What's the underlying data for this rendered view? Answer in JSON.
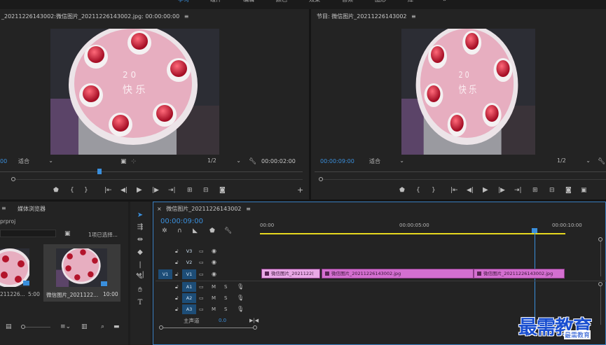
{
  "top_tabs": [
    "学习",
    "组件",
    "编辑",
    "颜色",
    "效果",
    "音频",
    "图形",
    "库"
  ],
  "source_monitor": {
    "title": "_20211226143002:微信图片_20211226143002.jpg: 00:00:00:00",
    "menu_icon": "≡",
    "timecode_left": "00",
    "fit": "适合",
    "resolution": "1/2",
    "timecode_right": "00:00:02:00"
  },
  "program_monitor": {
    "title": "节目: 微信图片_20211226143002",
    "menu_icon": "≡",
    "timecode_left": "00:00:09:00",
    "fit": "适合",
    "resolution": "1/2"
  },
  "image_text": {
    "line1": "2 0",
    "line2": "快 乐"
  },
  "project_panel": {
    "tab_menu": "≡",
    "tab_media_browser": "媒体浏览器",
    "project_file": "prproj",
    "selection_info": "1项已选择...",
    "items": [
      {
        "name": "211226...",
        "duration": "5:00"
      },
      {
        "name": "微信图片_2021122...",
        "duration": "10:00"
      }
    ]
  },
  "timeline": {
    "close": "×",
    "sequence_name": "微信图片_20211226143002",
    "menu_icon": "≡",
    "timecode": "00:00:09:00",
    "ruler": [
      "00:00",
      "00:00:05:00",
      "00:00:10:00"
    ],
    "tracks": {
      "v3": "V3",
      "v2": "V2",
      "v1": "V1",
      "v1_src": "V1",
      "a1": "A1",
      "a2": "A2",
      "a3": "A3",
      "m": "M",
      "s": "S",
      "master": "主声道",
      "master_value": "0.0"
    },
    "clips": [
      {
        "label": "微信图片_2021122("
      },
      {
        "label": "微信图片_20211226143002.jpg"
      },
      {
        "label": "微信图片_20211226143002.jpg"
      }
    ]
  },
  "watermark": {
    "main": "最需教育",
    "sub": "最需教育"
  },
  "colors": {
    "accent": "#3a8fdc",
    "clip": "#d46fd0",
    "work_area": "#e6d81f",
    "panel": "#232323"
  }
}
